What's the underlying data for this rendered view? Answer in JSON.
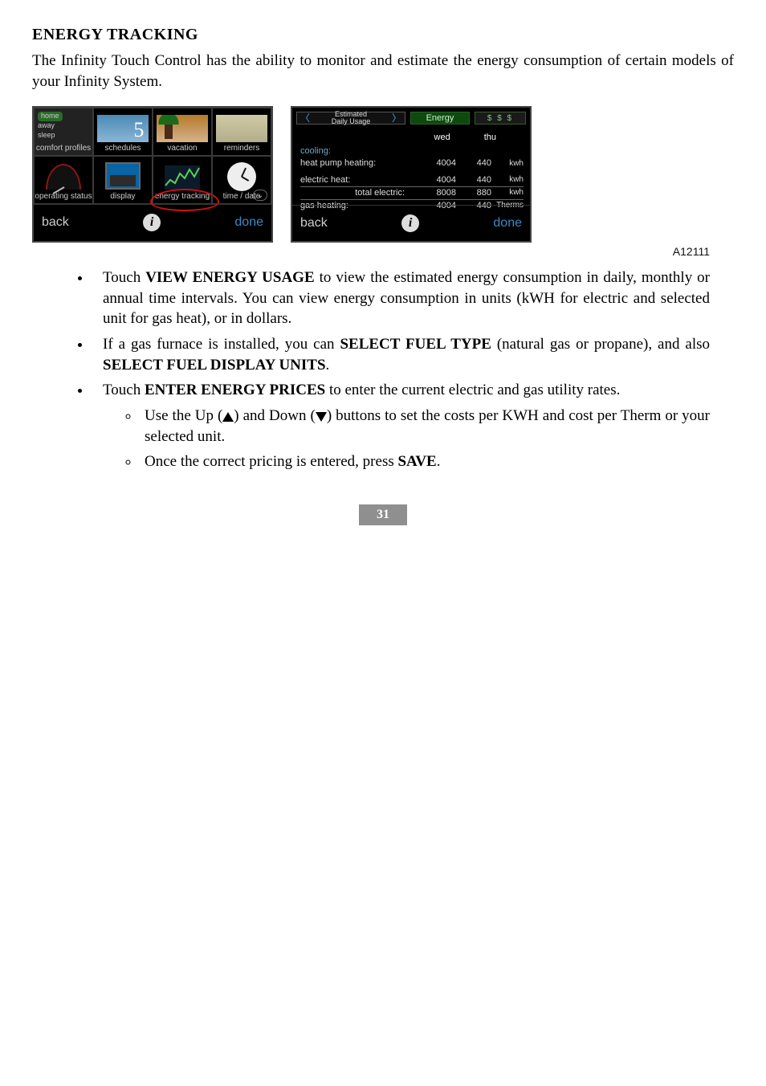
{
  "heading": "ENERGY TRACKING",
  "intro": "The Infinity Touch Control has the ability to monitor and estimate the energy consumption of certain models of your Infinity System.",
  "figure_code": "A12111",
  "page_number": "31",
  "left_screen": {
    "mode_options": {
      "home": "home",
      "away": "away",
      "sleep": "sleep"
    },
    "sched_number": "5",
    "tiles_top": {
      "comfort_profiles": "comfort profiles",
      "schedules": "schedules",
      "vacation": "vacation",
      "reminders": "reminders"
    },
    "tiles_mid": {
      "operating_status": "operating status",
      "display": "display",
      "energy_tracking": "energy tracking",
      "time_date": "time / date"
    },
    "back": "back",
    "done": "done"
  },
  "right_screen": {
    "tab_estimated": "Estimated\nDaily Usage",
    "tab_energy": "Energy",
    "tab_money": "$ $ $",
    "col_wed": "wed",
    "col_thu": "thu",
    "cooling_label": "cooling:",
    "rows": {
      "heatpump": {
        "label": "heat pump heating:",
        "c1": "4004",
        "c2": "440",
        "unit": "kwh"
      },
      "electric": {
        "label": "electric heat:",
        "c1": "4004",
        "c2": "440",
        "unit": "kwh"
      },
      "total": {
        "label": "total electric:",
        "c1": "8008",
        "c2": "880",
        "unit": "kwh"
      },
      "gas": {
        "label": "gas heating:",
        "c1": "4004",
        "c2": "440",
        "unit": "Therms"
      }
    },
    "back": "back",
    "done": "done"
  },
  "bullets": {
    "b1a": "Touch ",
    "b1_strong": "VIEW ENERGY USAGE",
    "b1b": " to view the estimated energy consumption in daily, monthly or annual time intervals. You can view energy consumption in units (kWH for electric and selected unit for gas heat), or in dollars.",
    "b2a": "If a gas furnace is installed, you can ",
    "b2_strong1": "SELECT FUEL TYPE",
    "b2b": " (natural gas or propane), and also ",
    "b2_strong2": "SELECT FUEL DISPLAY UNITS",
    "b2c": ".",
    "b3a": "Touch ",
    "b3_strong": "ENTER ENERGY PRICES",
    "b3b": " to enter the current electric and gas utility rates.",
    "sub1a": "Use the Up (",
    "sub1b": ") and Down (",
    "sub1c": ") buttons to set the costs per KWH and cost per Therm or your selected unit.",
    "sub2a": "Once the correct pricing is entered, press ",
    "sub2_strong": "SAVE",
    "sub2b": "."
  }
}
